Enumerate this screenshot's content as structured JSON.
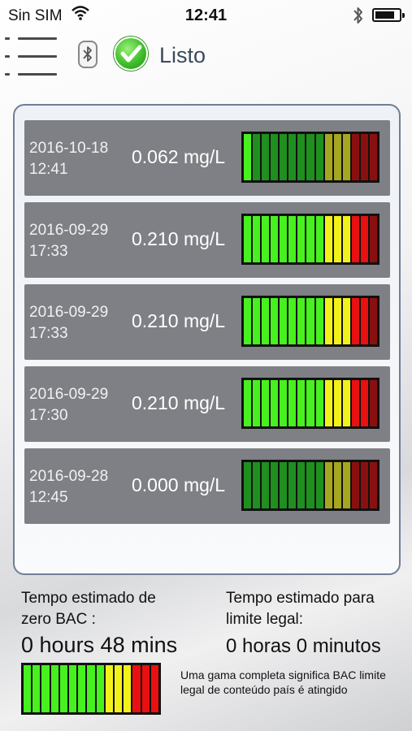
{
  "status_bar": {
    "carrier": "Sin SIM",
    "time": "12:41",
    "wifi_icon": "wifi-icon",
    "bluetooth_icon": "bluetooth-icon",
    "battery_icon": "battery-icon",
    "battery_level": 0.75
  },
  "toolbar": {
    "menu_icon": "hamburger-menu-icon",
    "device_icon": "bluetooth-device-icon",
    "status_icon": "checkmark-icon",
    "status_label": "Listo"
  },
  "colors": {
    "green_on": "#47f01f",
    "green_off": "#1f8f1f",
    "yellow_on": "#f2f21a",
    "yellow_off": "#a6a620",
    "red_on": "#e81010",
    "red_off": "#8a1010",
    "row_bg": "#7e8085",
    "panel_border": "#6f7f96",
    "status_label": "#3b4a5a"
  },
  "readings": [
    {
      "date": "2016-10-18",
      "time": "12:41",
      "value": "0.062 mg/L",
      "lit_segments": 1
    },
    {
      "date": "2016-09-29",
      "time": "17:33",
      "value": "0.210 mg/L",
      "lit_segments": 14
    },
    {
      "date": "2016-09-29",
      "time": "17:33",
      "value": "0.210 mg/L",
      "lit_segments": 14
    },
    {
      "date": "2016-09-29",
      "time": "17:30",
      "value": "0.210 mg/L",
      "lit_segments": 14
    },
    {
      "date": "2016-09-28",
      "time": "12:45",
      "value": "0.000 mg/L",
      "lit_segments": 0
    }
  ],
  "bar_pattern": [
    "g",
    "g",
    "g",
    "g",
    "g",
    "g",
    "g",
    "g",
    "g",
    "y",
    "y",
    "y",
    "r",
    "r",
    "r"
  ],
  "zero_bac": {
    "label_line1": "Tempo estimado de",
    "label_line2": "zero BAC :",
    "value": "0 hours 48 mins"
  },
  "legal_limit": {
    "label_line1": "Tempo estimado para",
    "label_line2": "limite legal:",
    "value": "0 horas 0 minutos"
  },
  "legend": {
    "lit_segments": 15,
    "note": "Uma gama completa significa BAC limite legal de conteúdo país é atingido"
  }
}
